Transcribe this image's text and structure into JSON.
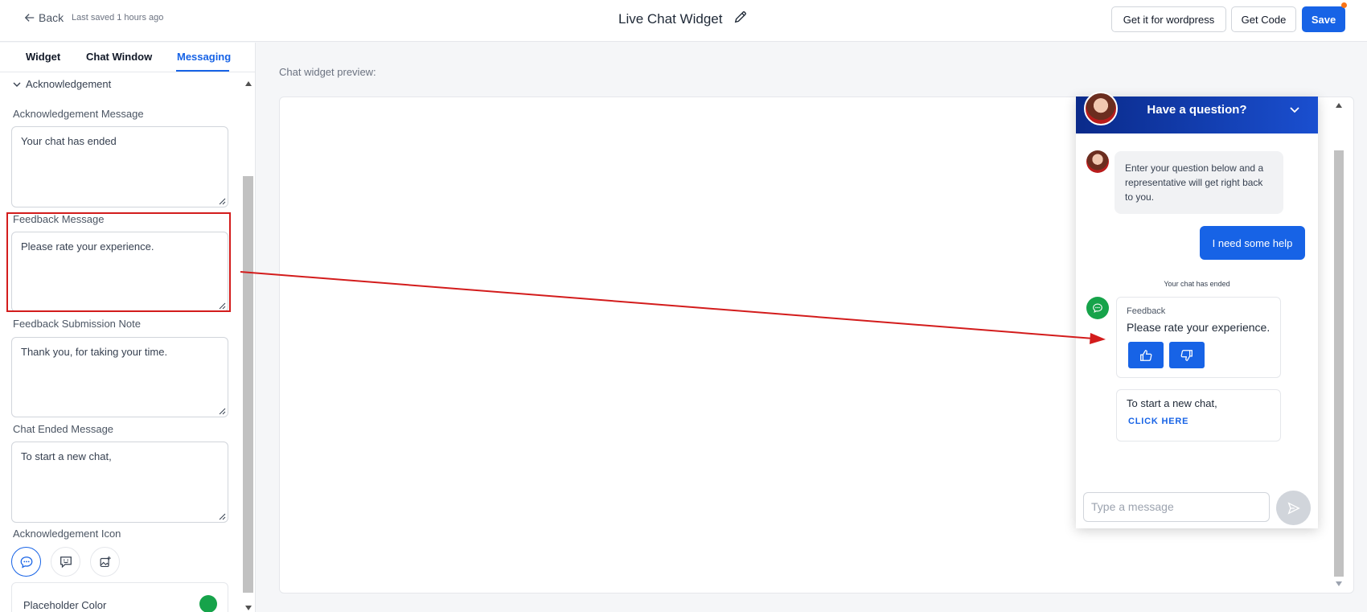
{
  "topbar": {
    "back_label": "Back",
    "saved_text": "Last saved 1 hours ago",
    "title": "Live Chat Widget",
    "wordpress_label": "Get it for wordpress",
    "get_code_label": "Get Code",
    "save_label": "Save"
  },
  "tabs": [
    {
      "label": "Widget",
      "active": false
    },
    {
      "label": "Chat Window",
      "active": false
    },
    {
      "label": "Messaging",
      "active": true
    }
  ],
  "section": {
    "title": "Acknowledgement"
  },
  "fields": {
    "ack_message": {
      "label": "Acknowledgement Message",
      "value": "Your chat has ended"
    },
    "feedback_message": {
      "label": "Feedback Message",
      "value": "Please rate your experience."
    },
    "feedback_note": {
      "label": "Feedback Submission Note",
      "value": "Thank you, for taking your time."
    },
    "chat_ended": {
      "label": "Chat Ended Message",
      "value": "To start a new chat,"
    }
  },
  "ack_icon": {
    "label": "Acknowledgement Icon",
    "options": [
      "chat-bubble-dots-icon",
      "chat-bubble-smile-icon",
      "image-add-icon"
    ],
    "selected": "chat-bubble-dots-icon"
  },
  "placeholder_color": {
    "label": "Placeholder Color",
    "value": "#16a34a"
  },
  "preview": {
    "label": "Chat widget preview:"
  },
  "widget": {
    "header_title": "Have a question?",
    "bot_message": "Enter your question below and a representative will get right back to you.",
    "user_message": "I need some help",
    "ended_text": "Your chat has ended",
    "feedback_title": "Feedback",
    "feedback_message": "Please rate your experience.",
    "new_chat_text": "To start a new chat,",
    "new_chat_link": "CLICK HERE",
    "input_placeholder": "Type a message"
  },
  "colors": {
    "accent": "#1763e6",
    "highlight": "#d31c1c",
    "feedback_icon": "#16a34a"
  }
}
